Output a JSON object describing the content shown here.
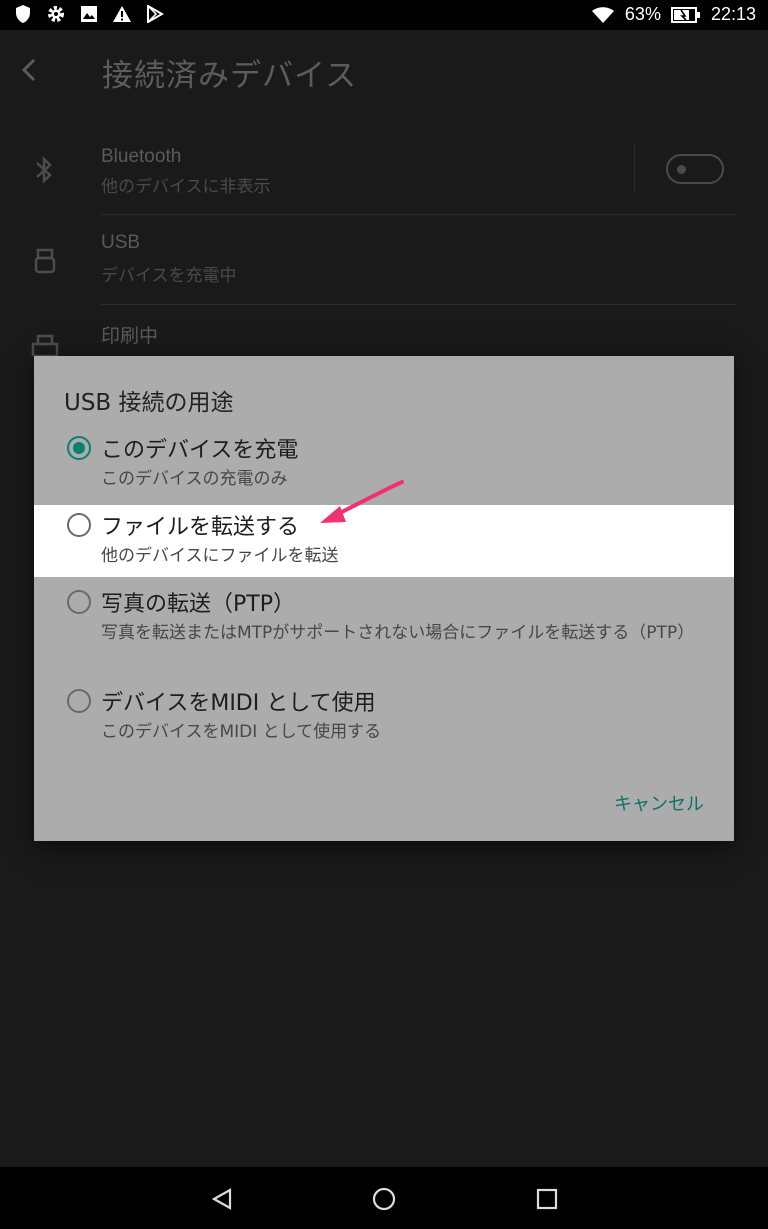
{
  "status_bar": {
    "icons_left": [
      "shield-icon",
      "gear-icon",
      "image-icon",
      "warning-icon",
      "play-store-icon"
    ],
    "battery_percent": "63%",
    "time": "22:13"
  },
  "app_bar": {
    "title": "接続済みデバイス"
  },
  "list": {
    "bluetooth": {
      "title": "Bluetooth",
      "subtitle": "他のデバイスに非表示",
      "toggle_on": false
    },
    "usb": {
      "title": "USB",
      "subtitle": "デバイスを充電中"
    },
    "printing": {
      "title": "印刷中"
    }
  },
  "dialog": {
    "title": "USB 接続の用途",
    "options": [
      {
        "label": "このデバイスを充電",
        "description": "このデバイスの充電のみ",
        "selected": true
      },
      {
        "label": "ファイルを転送する",
        "description": "他のデバイスにファイルを転送",
        "selected": false
      },
      {
        "label": "写真の転送（PTP）",
        "description": "写真を転送またはMTPがサポートされない場合にファイルを転送する（PTP）",
        "selected": false
      },
      {
        "label": "デバイスをMIDI として使用",
        "description": "このデバイスをMIDI として使用する",
        "selected": false
      }
    ],
    "cancel_label": "キャンセル"
  },
  "colors": {
    "accent": "#0b7f6f",
    "annotation_arrow": "#f0336e",
    "dialog_bg": "#acacac"
  },
  "nav_bar": {
    "icons": [
      "back-icon",
      "home-icon",
      "recents-icon"
    ]
  }
}
